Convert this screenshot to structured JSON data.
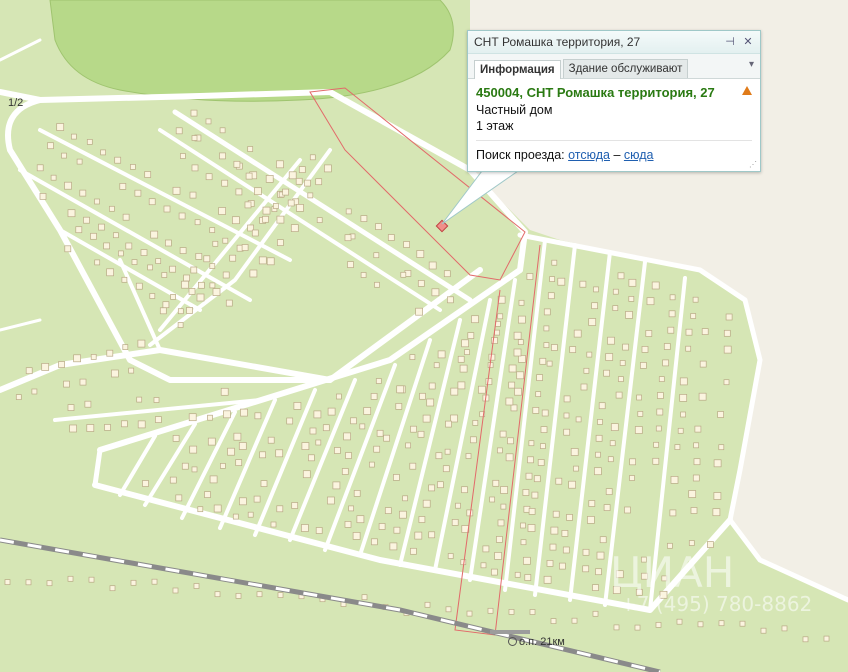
{
  "popup": {
    "title": "СНТ Ромашка территория, 27",
    "tabs": [
      "Информация",
      "Здание обслуживают"
    ],
    "address": "450004, СНТ Ромашка территория, 27",
    "type": "Частный дом",
    "floors": "1 этаж",
    "route_label": "Поиск проезда:",
    "route_from": "отсюда",
    "route_sep": "–",
    "route_to": "сюда"
  },
  "map": {
    "house_label": "1/2",
    "station_label": "о.п. 21км",
    "watermark_top": "ЦИАН",
    "watermark_phone": "+7 (495) 780-8862"
  },
  "colors": {
    "land": "#d6e6b5",
    "forest": "#b7d989",
    "road": "#ffffff",
    "building": "#fbf4df",
    "plot_boundary": "#e26a6a",
    "railway": "#8a8a8a",
    "address_text": "#2a7a12",
    "warning": "#e07b19"
  }
}
